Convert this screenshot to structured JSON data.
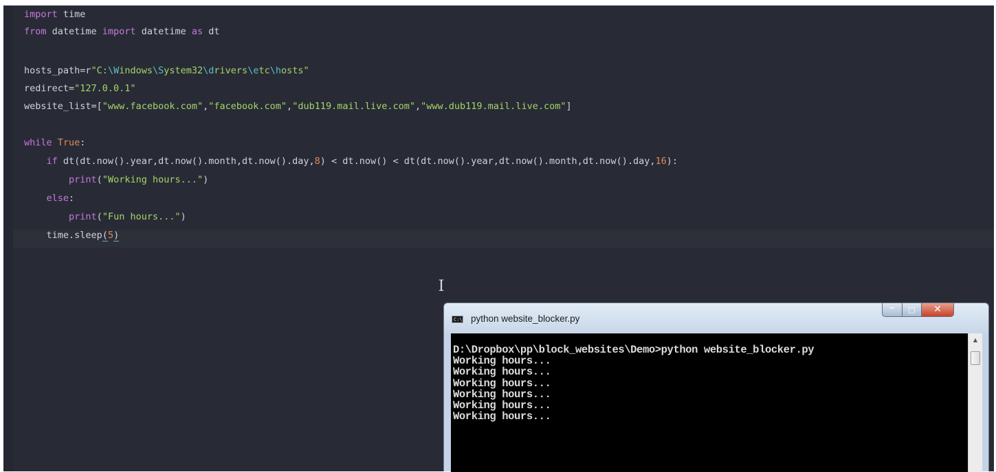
{
  "editor": {
    "lines": [
      {
        "id": "l1",
        "parts": [
          [
            "kw",
            "import"
          ],
          [
            "fn",
            " time"
          ]
        ]
      },
      {
        "id": "l2",
        "parts": [
          [
            "kw",
            "from"
          ],
          [
            "fn",
            " datetime "
          ],
          [
            "kw",
            "import"
          ],
          [
            "fn",
            " datetime "
          ],
          [
            "kw",
            "as"
          ],
          [
            "fn",
            " dt"
          ]
        ]
      },
      {
        "id": "l3",
        "parts": []
      },
      {
        "id": "l4",
        "parts": [
          [
            "fn",
            "hosts_path=r"
          ],
          [
            "str",
            "\"C:"
          ],
          [
            "esc",
            "\\W"
          ],
          [
            "str",
            "indows"
          ],
          [
            "esc",
            "\\S"
          ],
          [
            "str",
            "ystem32"
          ],
          [
            "esc",
            "\\d"
          ],
          [
            "str",
            "rivers"
          ],
          [
            "esc",
            "\\e"
          ],
          [
            "str",
            "tc"
          ],
          [
            "esc",
            "\\h"
          ],
          [
            "str",
            "osts\""
          ]
        ]
      },
      {
        "id": "l5",
        "parts": [
          [
            "fn",
            "redirect="
          ],
          [
            "str",
            "\"127.0.0.1\""
          ]
        ]
      },
      {
        "id": "l6",
        "parts": [
          [
            "fn",
            "website_list=["
          ],
          [
            "str",
            "\"www.facebook.com\""
          ],
          [
            "fn",
            ","
          ],
          [
            "str",
            "\"facebook.com\""
          ],
          [
            "fn",
            ","
          ],
          [
            "str",
            "\"dub119.mail.live.com\""
          ],
          [
            "fn",
            ","
          ],
          [
            "str",
            "\"www.dub119.mail.live.com\""
          ],
          [
            "fn",
            "]"
          ]
        ]
      },
      {
        "id": "l7",
        "parts": []
      },
      {
        "id": "l8",
        "parts": [
          [
            "kw",
            "while"
          ],
          [
            "fn",
            " "
          ],
          [
            "num",
            "True"
          ],
          [
            "fn",
            ":"
          ]
        ]
      },
      {
        "id": "l9",
        "parts": [
          [
            "fn",
            "    "
          ],
          [
            "kw",
            "if"
          ],
          [
            "fn",
            " dt(dt.now().year,dt.now().month,dt.now().day,"
          ],
          [
            "num",
            "8"
          ],
          [
            "fn",
            ") < dt.now() < dt(dt.now().year,dt.now().month,dt.now().day,"
          ],
          [
            "num",
            "16"
          ],
          [
            "fn",
            "):"
          ]
        ]
      },
      {
        "id": "l10",
        "parts": [
          [
            "fn",
            "        "
          ],
          [
            "kw",
            "print"
          ],
          [
            "fn",
            "("
          ],
          [
            "str",
            "\"Working hours...\""
          ],
          [
            "fn",
            ")"
          ]
        ]
      },
      {
        "id": "l11",
        "parts": [
          [
            "fn",
            "    "
          ],
          [
            "kw",
            "else"
          ],
          [
            "fn",
            ":"
          ]
        ]
      },
      {
        "id": "l12",
        "parts": [
          [
            "fn",
            "        "
          ],
          [
            "kw",
            "print"
          ],
          [
            "fn",
            "("
          ],
          [
            "str",
            "\"Fun hours...\""
          ],
          [
            "fn",
            ")"
          ]
        ]
      },
      {
        "id": "l13",
        "parts": [
          [
            "fn",
            "    time.sleep"
          ],
          [
            "under",
            "("
          ],
          [
            "num",
            "5"
          ],
          [
            "under",
            ")"
          ]
        ]
      }
    ],
    "cursor_glyph": "I"
  },
  "console": {
    "title": "python  website_blocker.py",
    "icon_text": "C:\\",
    "buttons": {
      "minimize": "‒",
      "maximize": "□",
      "close": "✕"
    },
    "scroll_up": "▲",
    "lines": [
      "D:\\Dropbox\\pp\\block_websites\\Demo>python website_blocker.py",
      "Working hours...",
      "Working hours...",
      "Working hours...",
      "Working hours...",
      "Working hours...",
      "Working hours..."
    ]
  },
  "colors": {
    "editor_bg": "#282b35",
    "keyword": "#c678dd",
    "string": "#a6d46b",
    "number": "#e0875a",
    "console_bg": "#000000"
  }
}
